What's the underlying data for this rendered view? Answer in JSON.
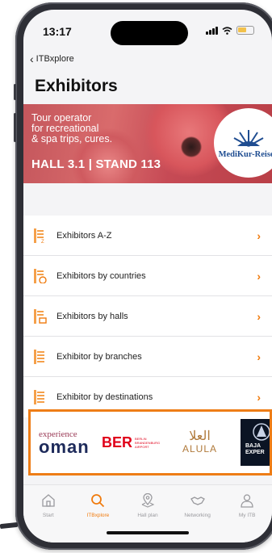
{
  "status_bar": {
    "time": "13:17"
  },
  "nav": {
    "back_label": "ITBxplore",
    "title": "Exhibitors"
  },
  "banner": {
    "lines": [
      "Tour operator",
      "for recreational",
      "& spa trips, cures."
    ],
    "hall": "HALL 3.1 | STAND 113",
    "logo_text": "MediKur-Reisen"
  },
  "menu": {
    "items": [
      {
        "label": "Exhibitors A-Z",
        "icon": "az-list-icon"
      },
      {
        "label": "Exhibitors by countries",
        "icon": "countries-list-icon"
      },
      {
        "label": "Exhibitors by halls",
        "icon": "halls-list-icon"
      },
      {
        "label": "Exhibitor by branches",
        "icon": "branches-list-icon"
      },
      {
        "label": "Exhibitor by destinations",
        "icon": "destinations-list-icon"
      }
    ]
  },
  "sponsors": {
    "oman_line1": "experience",
    "oman_line2": "oman",
    "ber": "BER",
    "ber_sub": "BERLIN BRANDENBURG AIRPORT",
    "alula_arabic": "العلا",
    "alula": "ALULA",
    "baja": "BAJA EXPER"
  },
  "tabbar": {
    "items": [
      {
        "label": "Start",
        "icon": "home-icon"
      },
      {
        "label": "ITBxplore",
        "icon": "search-icon",
        "active": true
      },
      {
        "label": "Hall plan",
        "icon": "map-pin-icon"
      },
      {
        "label": "Networking",
        "icon": "handshake-icon"
      },
      {
        "label": "My ITB",
        "icon": "user-icon"
      }
    ]
  },
  "colors": {
    "accent": "#f07b0e",
    "highlight_border": "#ee7d16",
    "banner_red": "#c64a55"
  }
}
